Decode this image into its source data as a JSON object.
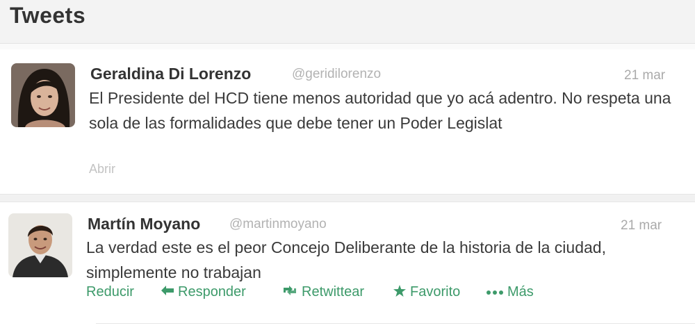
{
  "page": {
    "title": "Tweets"
  },
  "tweets": [
    {
      "name": "Geraldina Di Lorenzo",
      "handle": "@geridilorenzo",
      "time": "21 mar",
      "text": "El Presidente del HCD tiene menos autoridad que yo acá adentro. No respeta una sola de las formalidades que debe tener un Poder Legislat",
      "expand_label": "Abrir"
    },
    {
      "name": "Martín Moyano",
      "handle": "@martinmoyano",
      "time": "21 mar",
      "text": "La verdad este es el peor Concejo Deliberante de la historia de la ciudad, simplemente no trabajan",
      "actions": {
        "reduce": "Reducir",
        "reply": "Responder",
        "retweet": "Retwittear",
        "favorite": "Favorito",
        "more": "Más"
      }
    }
  ],
  "colors": {
    "action_green": "#3d9a6a",
    "handle_gray": "#b2b2b2",
    "text_dark": "#3a3a3a"
  },
  "icons": {
    "reply": "reply-arrow-icon",
    "retweet": "retweet-icon",
    "favorite": "star-icon",
    "more": "ellipsis-icon"
  }
}
